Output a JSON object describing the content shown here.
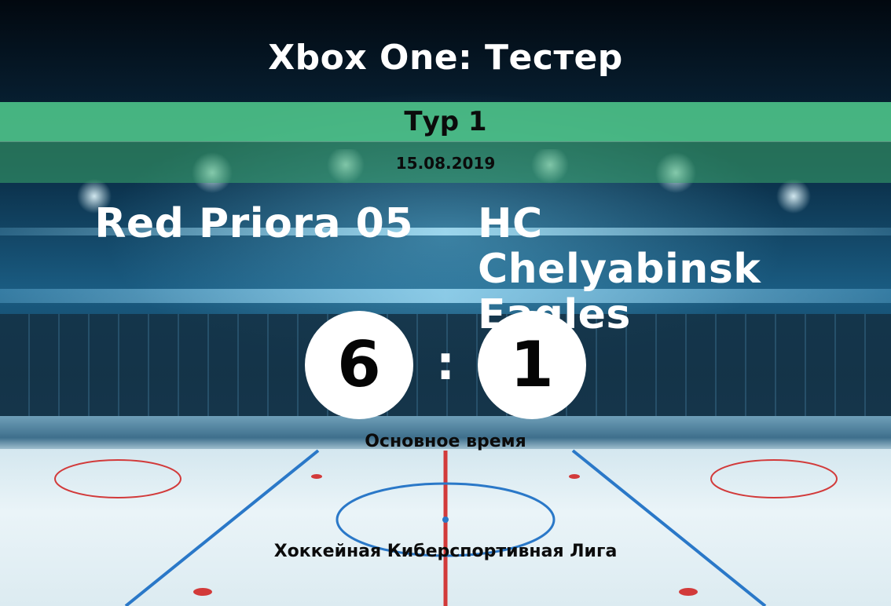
{
  "event": {
    "title": "Xbox One: Тестер",
    "round": "Тур 1",
    "date": "15.08.2019"
  },
  "match": {
    "home_team": "Red Priora 05",
    "away_team": "HC Chelyabinsk Eagles",
    "home_score": "6",
    "away_score": "1",
    "separator": ":",
    "period": "Основное время"
  },
  "footer": {
    "league": "Хоккейная Киберспортивная Лига"
  },
  "colors": {
    "band_green": "#50c88c",
    "score_circle": "#ffffff",
    "title_text": "#ffffff",
    "dark_text": "#0b0b0b"
  }
}
